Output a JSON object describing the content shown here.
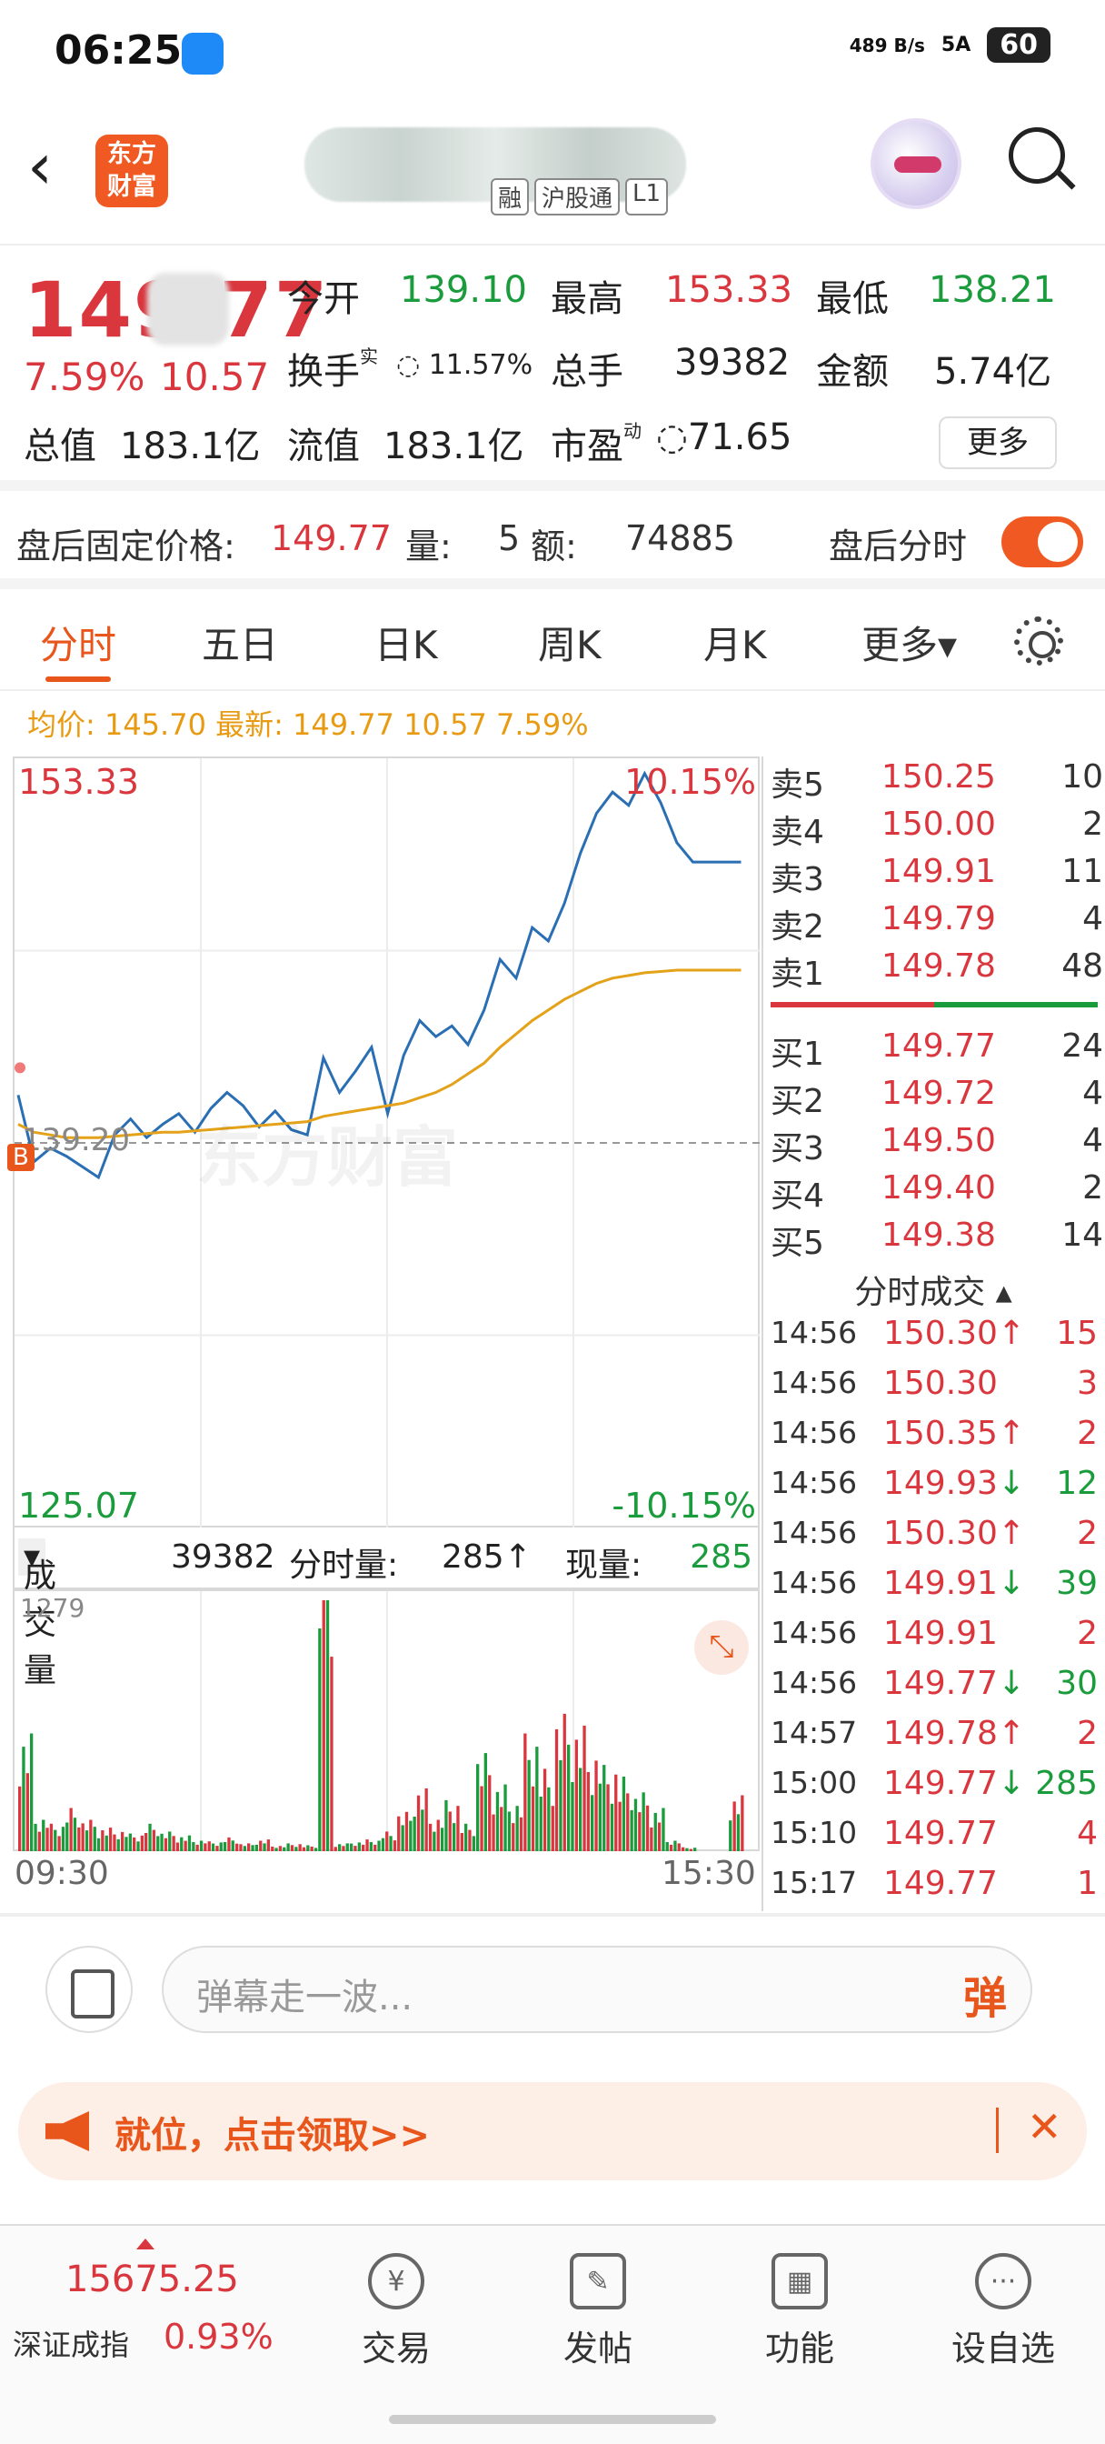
{
  "status_bar": {
    "time": "06:25",
    "net_speed": "489 B/s",
    "signal": "5A",
    "battery": "60"
  },
  "header": {
    "badges": [
      "融",
      "沪股通",
      "L1"
    ]
  },
  "quote": {
    "price": "149.77",
    "change_pct": "7.59%",
    "change": "10.57",
    "open_label": "今开",
    "open": "139.10",
    "high_label": "最高",
    "high": "153.33",
    "low_label": "最低",
    "low": "138.21",
    "turnover_label": "换手",
    "turnover_sup": "实",
    "turnover": "11.57%",
    "volume_label": "总手",
    "volume": "39382",
    "amount_label": "金额",
    "amount": "5.74亿",
    "mktcap_label": "总值",
    "mktcap": "183.1亿",
    "float_label": "流值",
    "float": "183.1亿",
    "pe_label": "市盈",
    "pe_sup": "动",
    "pe": "71.65",
    "more_button": "更多"
  },
  "after_hours": {
    "label": "盘后固定价格:",
    "price": "149.77",
    "vol_label": "量:",
    "vol": "5",
    "amt_label": "额:",
    "amt": "74885",
    "toggle_label": "盘后分时",
    "toggle_on": true
  },
  "tabs": [
    "分时",
    "五日",
    "日K",
    "周K",
    "月K",
    "更多▾"
  ],
  "avg_info": {
    "text": "均价: 145.70 最新: 149.77 10.57 7.59%"
  },
  "chart_labels": {
    "top_price": "153.33",
    "top_pct": "10.15%",
    "bottom_price": "125.07",
    "bottom_pct": "-10.15%",
    "prev_close": "139.20",
    "b_marker": "B",
    "watermark": "东方财富"
  },
  "volume_bar": {
    "select": "成交量",
    "total": "39382",
    "min_label": "分时量:",
    "min_vol": "285↑",
    "now_label": "现量:",
    "now_vol": "285",
    "axis_max": "1279"
  },
  "time_axis": {
    "start": "09:30",
    "end": "15:30"
  },
  "chart_data": {
    "type": "line",
    "title": "",
    "ylim": [
      125.07,
      153.33
    ],
    "prev_close": 139.2,
    "series": [
      {
        "name": "",
        "color": "#2a6fb3",
        "values": [
          141.0,
          138.5,
          139.0,
          138.7,
          138.3,
          137.9,
          139.5,
          140.1,
          139.4,
          139.9,
          140.3,
          139.6,
          140.5,
          141.1,
          140.6,
          139.8,
          140.4,
          139.7,
          139.5,
          142.4,
          141.1,
          141.9,
          142.8,
          140.3,
          142.5,
          143.8,
          143.2,
          143.6,
          142.9,
          144.2,
          146.1,
          145.4,
          147.3,
          146.8,
          148.2,
          150.1,
          151.6,
          152.4,
          151.9,
          153.1,
          152.0,
          150.5,
          149.77,
          149.77,
          149.77,
          149.77
        ]
      },
      {
        "name": "",
        "color": "#e3a21a",
        "values": [
          139.9,
          139.6,
          139.5,
          139.4,
          139.4,
          139.4,
          139.45,
          139.5,
          139.55,
          139.6,
          139.6,
          139.65,
          139.7,
          139.75,
          139.8,
          139.85,
          139.9,
          139.95,
          140.0,
          140.2,
          140.3,
          140.4,
          140.5,
          140.6,
          140.7,
          140.9,
          141.1,
          141.4,
          141.8,
          142.2,
          142.8,
          143.3,
          143.8,
          144.2,
          144.6,
          144.9,
          145.2,
          145.4,
          145.5,
          145.6,
          145.65,
          145.7,
          145.7,
          145.7,
          145.7,
          145.7
        ]
      }
    ],
    "volume": [
      600,
      180,
      140,
      220,
      160,
      120,
      110,
      90,
      140,
      100,
      80,
      60,
      50,
      70,
      40,
      60,
      30,
      40,
      30,
      1279,
      40,
      50,
      60,
      100,
      200,
      320,
      180,
      260,
      140,
      500,
      340,
      260,
      600,
      420,
      700,
      640,
      520,
      440,
      380,
      300,
      220,
      60,
      20,
      0,
      0,
      285
    ]
  },
  "order_book": {
    "asks": [
      {
        "label": "卖5",
        "price": "150.25",
        "vol": "10"
      },
      {
        "label": "卖4",
        "price": "150.00",
        "vol": "2"
      },
      {
        "label": "卖3",
        "price": "149.91",
        "vol": "11"
      },
      {
        "label": "卖2",
        "price": "149.79",
        "vol": "4"
      },
      {
        "label": "卖1",
        "price": "149.78",
        "vol": "48"
      }
    ],
    "bids": [
      {
        "label": "买1",
        "price": "149.77",
        "vol": "24"
      },
      {
        "label": "买2",
        "price": "149.72",
        "vol": "4"
      },
      {
        "label": "买3",
        "price": "149.50",
        "vol": "4"
      },
      {
        "label": "买4",
        "price": "149.40",
        "vol": "2"
      },
      {
        "label": "买5",
        "price": "149.38",
        "vol": "14"
      }
    ]
  },
  "trades_header": "分时成交 ▴",
  "trades": [
    {
      "time": "14:56",
      "price": "150.30↑",
      "vol": "15",
      "dir": "up"
    },
    {
      "time": "14:56",
      "price": "150.30",
      "vol": "3",
      "dir": "up"
    },
    {
      "time": "14:56",
      "price": "150.35↑",
      "vol": "2",
      "dir": "up"
    },
    {
      "time": "14:56",
      "price": "149.93↓",
      "vol": "12",
      "dir": "down"
    },
    {
      "time": "14:56",
      "price": "150.30↑",
      "vol": "2",
      "dir": "up"
    },
    {
      "time": "14:56",
      "price": "149.91↓",
      "vol": "39",
      "dir": "down"
    },
    {
      "time": "14:56",
      "price": "149.91",
      "vol": "2",
      "dir": "up"
    },
    {
      "time": "14:56",
      "price": "149.77↓",
      "vol": "30",
      "dir": "down"
    },
    {
      "time": "14:57",
      "price": "149.78↑",
      "vol": "2",
      "dir": "up"
    },
    {
      "time": "15:00",
      "price": "149.77↓",
      "vol": "285",
      "dir": "down"
    },
    {
      "time": "15:10",
      "price": "149.77",
      "vol": "4",
      "dir": "up"
    },
    {
      "time": "15:17",
      "price": "149.77",
      "vol": "1",
      "dir": "up"
    }
  ],
  "comment_bar": {
    "placeholder": "弹幕走一波...",
    "send_icon": "弹"
  },
  "promo": {
    "text": "就位，点击领取>>"
  },
  "bottom_nav": {
    "index_value": "15675.25",
    "index_name": "深证成指",
    "index_pct": "0.93%",
    "items": [
      {
        "label": "交易",
        "icon": "¥"
      },
      {
        "label": "发帖",
        "icon": "✎"
      },
      {
        "label": "功能",
        "icon": "▦"
      },
      {
        "label": "设自选",
        "icon": "···"
      }
    ]
  }
}
